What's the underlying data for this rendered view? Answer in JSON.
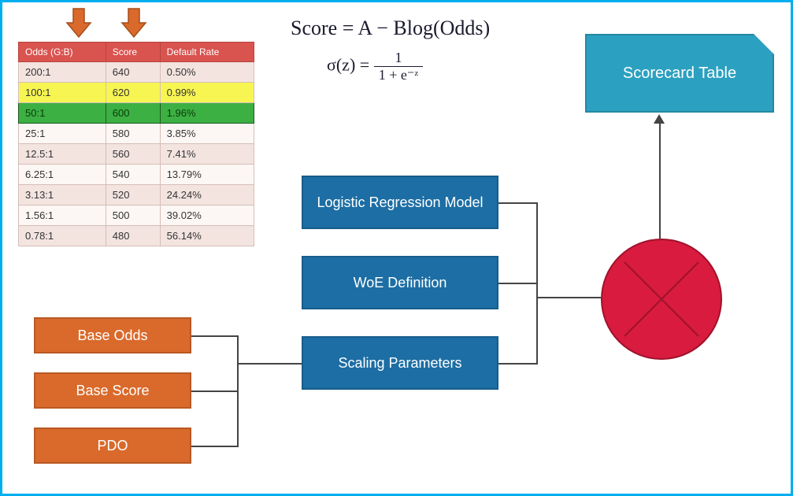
{
  "formulas": {
    "score": "Score = A − Blog(Odds)",
    "sigmoid_lhs": "σ(z) = ",
    "sigmoid_num": "1",
    "sigmoid_den": "1 + e⁻ᶻ"
  },
  "table": {
    "headers": [
      "Odds (G:B)",
      "Score",
      "Default Rate"
    ],
    "rows": [
      {
        "odds": "200:1",
        "score": "640",
        "rate": "0.50%",
        "hl": ""
      },
      {
        "odds": "100:1",
        "score": "620",
        "rate": "0.99%",
        "hl": "yellow"
      },
      {
        "odds": "50:1",
        "score": "600",
        "rate": "1.96%",
        "hl": "green"
      },
      {
        "odds": "25:1",
        "score": "580",
        "rate": "3.85%",
        "hl": ""
      },
      {
        "odds": "12.5:1",
        "score": "560",
        "rate": "7.41%",
        "hl": ""
      },
      {
        "odds": "6.25:1",
        "score": "540",
        "rate": "13.79%",
        "hl": ""
      },
      {
        "odds": "3.13:1",
        "score": "520",
        "rate": "24.24%",
        "hl": ""
      },
      {
        "odds": "1.56:1",
        "score": "500",
        "rate": "39.02%",
        "hl": ""
      },
      {
        "odds": "0.78:1",
        "score": "480",
        "rate": "56.14%",
        "hl": ""
      }
    ]
  },
  "boxes": {
    "base_odds": "Base Odds",
    "base_score": "Base Score",
    "pdo": "PDO",
    "logreg": "Logistic Regression Model",
    "woe": "WoE Definition",
    "scaling": "Scaling Parameters",
    "scorecard": "Scorecard Table"
  }
}
